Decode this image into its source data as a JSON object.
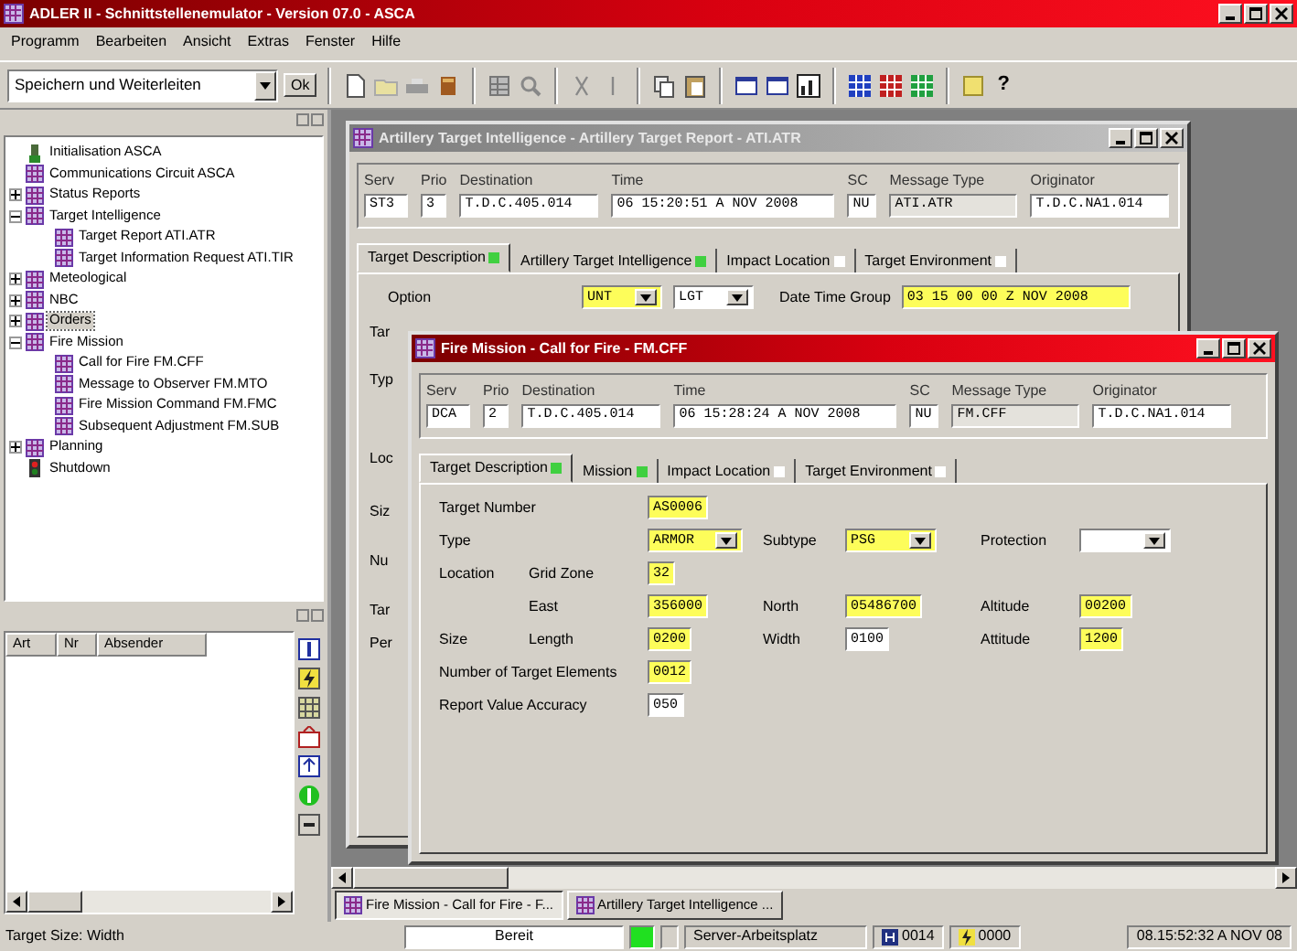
{
  "window": {
    "title": "ADLER II - Schnittstellenemulator - Version 07.0 - ASCA",
    "active": true
  },
  "menu": [
    "Programm",
    "Bearbeiten",
    "Ansicht",
    "Extras",
    "Fenster",
    "Hilfe"
  ],
  "toolbar": {
    "combo": "Speichern und Weiterleiten",
    "ok": "Ok",
    "help": "?"
  },
  "tree": [
    {
      "label": "Initialisation ASCA",
      "kind": "start",
      "selected": false
    },
    {
      "label": "Communications Circuit ASCA",
      "kind": "module",
      "selected": false
    },
    {
      "label": "Status Reports",
      "kind": "module",
      "expanded": false,
      "selected": false
    },
    {
      "label": "Target Intelligence",
      "kind": "module",
      "expanded": true,
      "selected": false,
      "children": [
        {
          "label": "Target Report ATI.ATR",
          "kind": "module",
          "selected": false
        },
        {
          "label": "Target Information Request ATI.TIR",
          "kind": "module",
          "selected": false
        }
      ]
    },
    {
      "label": "Meteological",
      "kind": "module",
      "expanded": false,
      "selected": false
    },
    {
      "label": "NBC",
      "kind": "module",
      "expanded": false,
      "selected": false
    },
    {
      "label": "Orders",
      "kind": "module",
      "expanded": false,
      "selected": true
    },
    {
      "label": "Fire Mission",
      "kind": "module",
      "expanded": true,
      "selected": false,
      "children": [
        {
          "label": "Call for Fire FM.CFF",
          "kind": "module",
          "selected": false
        },
        {
          "label": "Message to Observer FM.MTO",
          "kind": "module",
          "selected": false
        },
        {
          "label": "Fire Mission Command FM.FMC",
          "kind": "module",
          "selected": false
        },
        {
          "label": "Subsequent Adjustment FM.SUB",
          "kind": "module",
          "selected": false
        }
      ]
    },
    {
      "label": "Planning",
      "kind": "module",
      "expanded": false,
      "selected": false
    },
    {
      "label": "Shutdown",
      "kind": "stop",
      "selected": false
    }
  ],
  "messages": {
    "columns": [
      "Art",
      "Nr",
      "Absender"
    ]
  },
  "report_window": {
    "title": "Artillery Target Intelligence - Artillery Target Report - ATI.ATR",
    "active": false,
    "header": [
      {
        "label": "Serv",
        "value": "ST3"
      },
      {
        "label": "Prio",
        "value": "3"
      },
      {
        "label": "Destination",
        "value": "T.D.C.405.014"
      },
      {
        "label": "Time",
        "value": "06 15:20:51 A NOV 2008"
      },
      {
        "label": "SC",
        "value": "NU"
      },
      {
        "label": "Message Type",
        "value": "ATI.ATR"
      },
      {
        "label": "Originator",
        "value": "T.D.C.NA1.014"
      }
    ],
    "tabs": [
      {
        "label": "Target Description",
        "complete": true,
        "selected": true
      },
      {
        "label": "Artillery Target Intelligence",
        "complete": true,
        "selected": false
      },
      {
        "label": "Impact Location",
        "complete": false,
        "selected": false
      },
      {
        "label": "Target Environment",
        "complete": false,
        "selected": false
      }
    ],
    "option": {
      "label": "Option",
      "fields": [
        {
          "value": "UNT",
          "highlighted": true
        },
        {
          "value": "LGT",
          "highlighted": false
        }
      ]
    },
    "date_time_group": {
      "label": "Date Time Group",
      "value": "03 15 00 00 Z NOV 2008",
      "highlighted": true
    },
    "cut_labels": [
      "Tar",
      "Typ",
      "Loc",
      "Siz",
      "Nu",
      "Tar",
      "Per"
    ]
  },
  "fire_window": {
    "title": "Fire Mission - Call for Fire - FM.CFF",
    "active": true,
    "header": [
      {
        "label": "Serv",
        "value": "DCA"
      },
      {
        "label": "Prio",
        "value": "2"
      },
      {
        "label": "Destination",
        "value": "T.D.C.405.014"
      },
      {
        "label": "Time",
        "value": "06 15:28:24 A NOV 2008"
      },
      {
        "label": "SC",
        "value": "NU"
      },
      {
        "label": "Message Type",
        "value": "FM.CFF"
      },
      {
        "label": "Originator",
        "value": "T.D.C.NA1.014"
      }
    ],
    "tabs": [
      {
        "label": "Target Description",
        "complete": true,
        "selected": true
      },
      {
        "label": "Mission",
        "complete": true,
        "selected": false
      },
      {
        "label": "Impact Location",
        "complete": false,
        "selected": false
      },
      {
        "label": "Target Environment",
        "complete": false,
        "selected": false
      }
    ],
    "rows": [
      {
        "label": "Target Number",
        "fields": [
          {
            "kind": "text",
            "value": "AS0006",
            "highlighted": true
          }
        ]
      },
      {
        "label": "Type",
        "fields": [
          {
            "kind": "select",
            "value": "ARMOR",
            "highlighted": true
          },
          {
            "label": "Subtype",
            "kind": "select",
            "value": "PSG",
            "highlighted": true
          },
          {
            "label": "Protection",
            "kind": "select",
            "highlighted": false
          }
        ]
      },
      {
        "label": "Location",
        "sublabel": "Grid Zone",
        "fields": [
          {
            "kind": "text",
            "value": "32",
            "highlighted": true
          }
        ]
      },
      {
        "sublabel": "East",
        "fields": [
          {
            "kind": "text",
            "value": "356000",
            "highlighted": true
          },
          {
            "label": "North",
            "kind": "text",
            "value": "05486700",
            "highlighted": true
          },
          {
            "label": "Altitude",
            "kind": "text",
            "value": "00200",
            "highlighted": true
          }
        ]
      },
      {
        "label": "Size",
        "sublabel": "Length",
        "fields": [
          {
            "kind": "text",
            "value": "0200",
            "highlighted": true
          },
          {
            "label": "Width",
            "kind": "text",
            "value": "0100",
            "highlighted": false
          },
          {
            "label": "Attitude",
            "kind": "text",
            "value": "1200",
            "highlighted": true
          }
        ]
      },
      {
        "label": "Number of Target Elements",
        "fields": [
          {
            "kind": "text",
            "value": "0012",
            "highlighted": true
          }
        ]
      },
      {
        "label": "Report Value Accuracy",
        "fields": [
          {
            "kind": "text",
            "value": "050",
            "highlighted": false
          }
        ]
      }
    ]
  },
  "taskbar": [
    {
      "label": "Fire Mission - Call for Fire - F...",
      "selected": true
    },
    {
      "label": "Artillery Target Intelligence ...",
      "selected": false
    }
  ],
  "status_bar": {
    "hint": "Target Size: Width",
    "state": "Bereit",
    "connected": true,
    "workplace": "Server-Arbeitsplatz",
    "counter_1": "0014",
    "counter_2": "0000",
    "time": "08.15:52:32 A NOV 08"
  }
}
